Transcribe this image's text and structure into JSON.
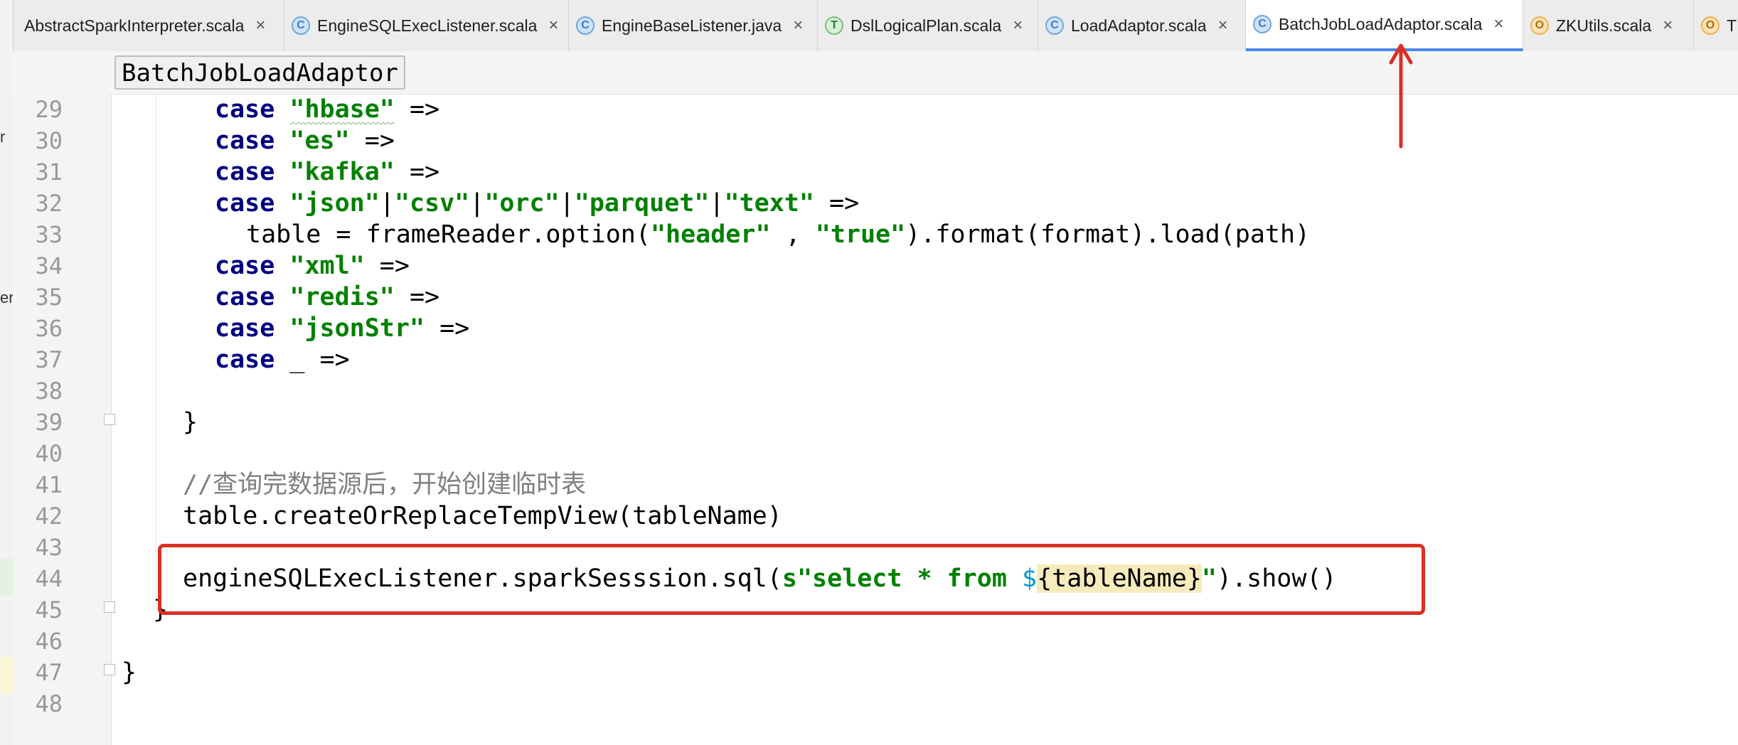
{
  "tabs": [
    {
      "label": "AbstractSparkInterpreter.scala",
      "icon": "object-icon",
      "icon_letter": "",
      "active": false
    },
    {
      "label": "EngineSQLExecListener.scala",
      "icon": "class-icon",
      "icon_letter": "C",
      "active": false
    },
    {
      "label": "EngineBaseListener.java",
      "icon": "class-icon",
      "icon_letter": "C",
      "active": false
    },
    {
      "label": "DslLogicalPlan.scala",
      "icon": "trait-icon",
      "icon_letter": "T",
      "active": false
    },
    {
      "label": "LoadAdaptor.scala",
      "icon": "class-icon",
      "icon_letter": "C",
      "active": false
    },
    {
      "label": "BatchJobLoadAdaptor.scala",
      "icon": "class-icon",
      "icon_letter": "C",
      "active": true
    },
    {
      "label": "ZKUtils.scala",
      "icon": "object-icon",
      "icon_letter": "O",
      "active": false
    },
    {
      "label": "T",
      "icon": "object-icon",
      "icon_letter": "O",
      "active": false
    }
  ],
  "close_glyph": "×",
  "breadcrumb": "BatchJobLoadAdaptor",
  "left_fragments": [
    "r",
    "er"
  ],
  "line_numbers": [
    "29",
    "30",
    "31",
    "32",
    "33",
    "34",
    "35",
    "36",
    "37",
    "38",
    "39",
    "40",
    "41",
    "42",
    "43",
    "44",
    "45",
    "46",
    "47",
    "48"
  ],
  "code": {
    "l29": {
      "kw": "case",
      "str": "\"hbase\"",
      "rest": " =>"
    },
    "l30": {
      "kw": "case",
      "str": "\"es\"",
      "rest": " =>"
    },
    "l31": {
      "kw": "case",
      "str": "\"kafka\"",
      "rest": " =>"
    },
    "l32": {
      "kw": "case",
      "s1": "\"json\"",
      "p1": "|",
      "s2": "\"csv\"",
      "p2": "|",
      "s3": "\"orc\"",
      "p3": "|",
      "s4": "\"parquet\"",
      "p4": "|",
      "s5": "\"text\"",
      "rest": " =>"
    },
    "l33": {
      "a": "table = frameReader.option(",
      "s1": "\"header\"",
      "b": " , ",
      "s2": "\"true\"",
      "c": ").format(format).load(path)"
    },
    "l34": {
      "kw": "case",
      "str": "\"xml\"",
      "rest": " =>"
    },
    "l35": {
      "kw": "case",
      "str": "\"redis\"",
      "rest": " =>"
    },
    "l36": {
      "kw": "case",
      "str": "\"jsonStr\"",
      "rest": " =>"
    },
    "l37": {
      "kw": "case",
      "rest": " _ =>"
    },
    "l39": "}",
    "l41": "//查询完数据源后，开始创建临时表",
    "l42": "table.createOrReplaceTempView(tableName)",
    "l44": {
      "a": "engineSQLExecListener.sparkSesssion.sql(",
      "s1": "s\"select * from ",
      "dollar": "$",
      "hl": "{tableName}",
      "s2": "\"",
      "c": ").show()"
    },
    "l45": "}",
    "l47": "}"
  },
  "colors": {
    "keyword": "#000080",
    "string": "#008000",
    "comment": "#808080",
    "annotation_red": "#d93025",
    "active_tab_underline": "#4a86e8"
  }
}
